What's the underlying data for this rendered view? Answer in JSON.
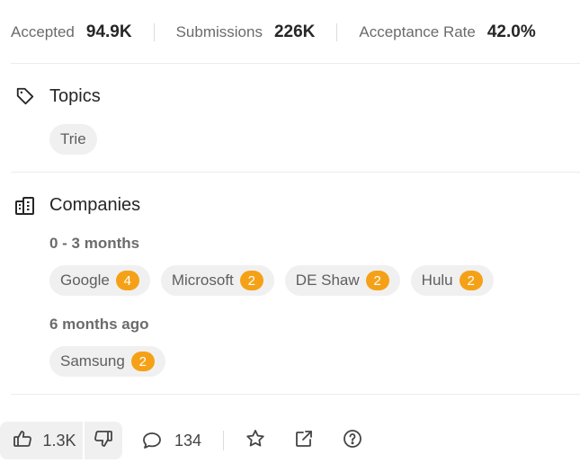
{
  "stats": [
    {
      "label": "Accepted",
      "value": "94.9K"
    },
    {
      "label": "Submissions",
      "value": "226K"
    },
    {
      "label": "Acceptance Rate",
      "value": "42.0%"
    }
  ],
  "topics": {
    "title": "Topics",
    "icon": "tag-icon",
    "chips": [
      "Trie"
    ]
  },
  "companies": {
    "title": "Companies",
    "icon": "building-icon",
    "groups": [
      {
        "heading": "0 - 3 months",
        "chips": [
          {
            "name": "Google",
            "count": "4"
          },
          {
            "name": "Microsoft",
            "count": "2"
          },
          {
            "name": "DE Shaw",
            "count": "2"
          },
          {
            "name": "Hulu",
            "count": "2"
          }
        ]
      },
      {
        "heading": "6 months ago",
        "chips": [
          {
            "name": "Samsung",
            "count": "2"
          }
        ]
      }
    ]
  },
  "actions": {
    "likes": "1.3K",
    "comments": "134",
    "icons": [
      "thumbs-up-icon",
      "thumbs-down-icon",
      "comment-icon",
      "star-icon",
      "external-link-icon",
      "help-icon"
    ]
  },
  "colors": {
    "badge": "#f5a117",
    "chip_bg": "#f0f0f0",
    "muted_text": "#6b6b6b"
  }
}
